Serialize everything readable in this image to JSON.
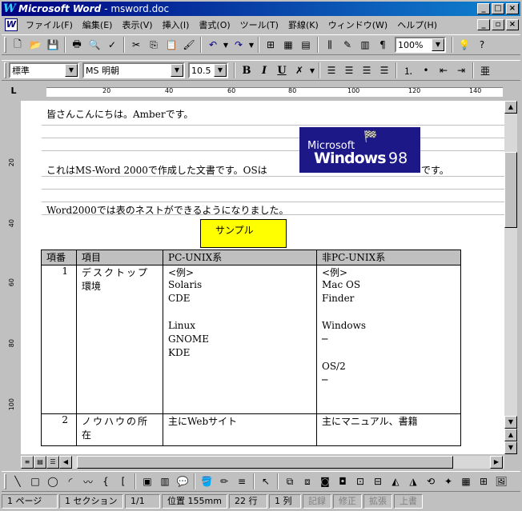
{
  "window": {
    "app_title": "Microsoft Word",
    "doc_title": "- msword.doc"
  },
  "menu": [
    "ファイル(F)",
    "編集(E)",
    "表示(V)",
    "挿入(I)",
    "書式(O)",
    "ツール(T)",
    "罫線(K)",
    "ウィンドウ(W)",
    "ヘルプ(H)"
  ],
  "standard_toolbar": {
    "zoom": "100%"
  },
  "format_toolbar": {
    "style": "標準",
    "font": "MS 明朝",
    "size": "10.5",
    "bold": "B",
    "italic": "I",
    "underline": "U"
  },
  "ruler": {
    "h_numbers": [
      "20",
      "40",
      "60",
      "80",
      "100",
      "120",
      "140"
    ],
    "v_numbers": [
      "20",
      "40",
      "60",
      "80",
      "100"
    ]
  },
  "document": {
    "line1": "皆さんこんにちは。Amberです。",
    "line2a": "これはMS-Word 2000で作成した文書です。OSは",
    "line2b": "です。",
    "line3": "Word2000では表のネストができるようになりました。",
    "win98_logo": {
      "ms": "Microsoft",
      "windows": "Windows",
      "ver": "98"
    },
    "sample_box": "サンプル",
    "table": {
      "headers": [
        "項番",
        "項目",
        "PC-UNIX系",
        "非PC-UNIX系"
      ],
      "rows": [
        {
          "no": "1",
          "item_lines": [
            "デスクトップ",
            "環境"
          ],
          "unix_lines": [
            "<例>",
            "Solaris",
            "CDE",
            "",
            "Linux",
            "GNOME",
            "KDE"
          ],
          "nonunix_lines": [
            "<例>",
            "Mac OS",
            "Finder",
            "",
            "Windows",
            "─",
            "",
            "OS/2",
            "─"
          ]
        },
        {
          "no": "2",
          "item_lines": [
            "ノウハウの所",
            "在"
          ],
          "unix_lines": [
            "主にWebサイト"
          ],
          "nonunix_lines": [
            "主にマニュアル、書籍"
          ]
        }
      ]
    }
  },
  "status": {
    "page": "1 ページ",
    "section": "1 セクション",
    "pages": "1/1",
    "position": "位置 155mm",
    "line": "22 行",
    "col": "1 列",
    "rec": "記録",
    "rev": "修正",
    "ext": "拡張",
    "ovr": "上書"
  }
}
